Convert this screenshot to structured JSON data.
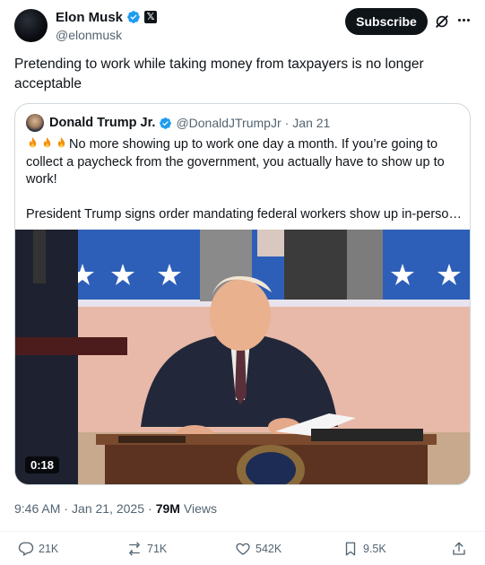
{
  "author": {
    "display_name": "Elon Musk",
    "handle": "@elonmusk",
    "badges": [
      "verified-icon",
      "x-affiliate-icon"
    ],
    "badge_letter": "𝕏"
  },
  "subscribe_label": "Subscribe",
  "header_icons": [
    "grok-icon",
    "more-icon"
  ],
  "post_text": "Pretending to work while taking money from taxpayers is no longer acceptable",
  "quote": {
    "display_name": "Donald Trump Jr.",
    "handle": "@DonaldJTrumpJr",
    "separator": "·",
    "date": "Jan 21",
    "emoji": "fire fire fire",
    "text_line": "No more showing up to work one day a month. If you’re going to collect a paycheck from the government, you actually have to show up to work!",
    "link_text": "President Trump signs order mandating federal workers show up in-person f...",
    "video_duration": "0:18"
  },
  "meta": {
    "time": "9:46 AM",
    "separator": "·",
    "date": "Jan 21, 2025",
    "separator2": "·",
    "views_count": "79M",
    "views_label": "Views"
  },
  "actions": {
    "replies": "21K",
    "reposts": "71K",
    "likes": "542K",
    "bookmarks": "9.5K"
  },
  "colors": {
    "text": "#0f1419",
    "secondary": "#536471",
    "verified": "#1d9bf0",
    "border": "#cfd9de"
  }
}
